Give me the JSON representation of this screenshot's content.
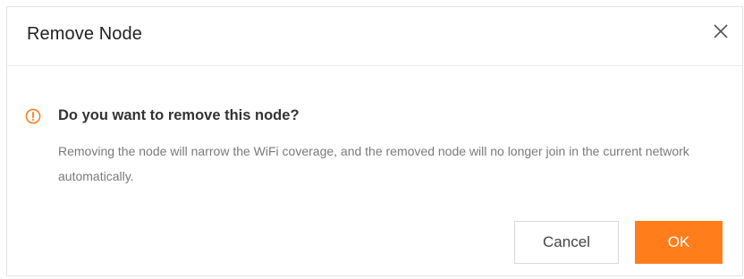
{
  "dialog": {
    "title": "Remove Node",
    "close_icon": "close-icon",
    "warning_icon": "exclamation-circle-icon",
    "question": "Do you want to remove this node?",
    "description": "Removing the node will narrow the WiFi coverage, and the removed node will no longer join in the current network automatically.",
    "cancel_label": "Cancel",
    "ok_label": "OK"
  },
  "colors": {
    "accent": "#ff7e1b",
    "title_text": "#222222",
    "description_text": "#7a7a7a",
    "border": "#e4e4e4"
  }
}
